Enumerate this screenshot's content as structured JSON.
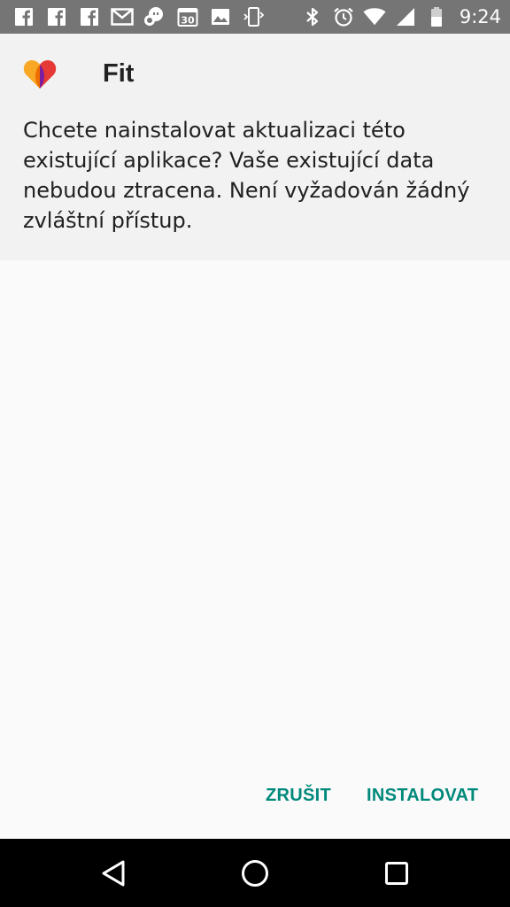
{
  "status_bar": {
    "time": "9:24",
    "calendar_day": "30",
    "notification_icons": [
      "facebook-icon",
      "facebook-icon",
      "facebook-icon",
      "gmail-icon",
      "hangouts-icon",
      "calendar-icon",
      "image-icon",
      "phone-sync-icon"
    ],
    "system_icons": [
      "bluetooth-icon",
      "alarm-icon",
      "wifi-icon",
      "cell-signal-icon",
      "battery-icon"
    ]
  },
  "app": {
    "name": "Fit",
    "icon": "google-fit-heart-icon",
    "colors": {
      "heart_orange": "#f9a825",
      "heart_red": "#e53935",
      "heart_purple": "#7b1fa2"
    }
  },
  "dialog": {
    "message": "Chcete nainstalovat aktualizaci této existující aplikace? Vaše existující data nebudou ztracena. Není vyžadován žádný zvláštní přístup."
  },
  "buttons": {
    "cancel_label": "ZRUŠIT",
    "install_label": "INSTALOVAT",
    "accent_color": "#00897b"
  },
  "nav_bar": {
    "icons": [
      "back-icon",
      "home-icon",
      "recents-icon"
    ]
  }
}
